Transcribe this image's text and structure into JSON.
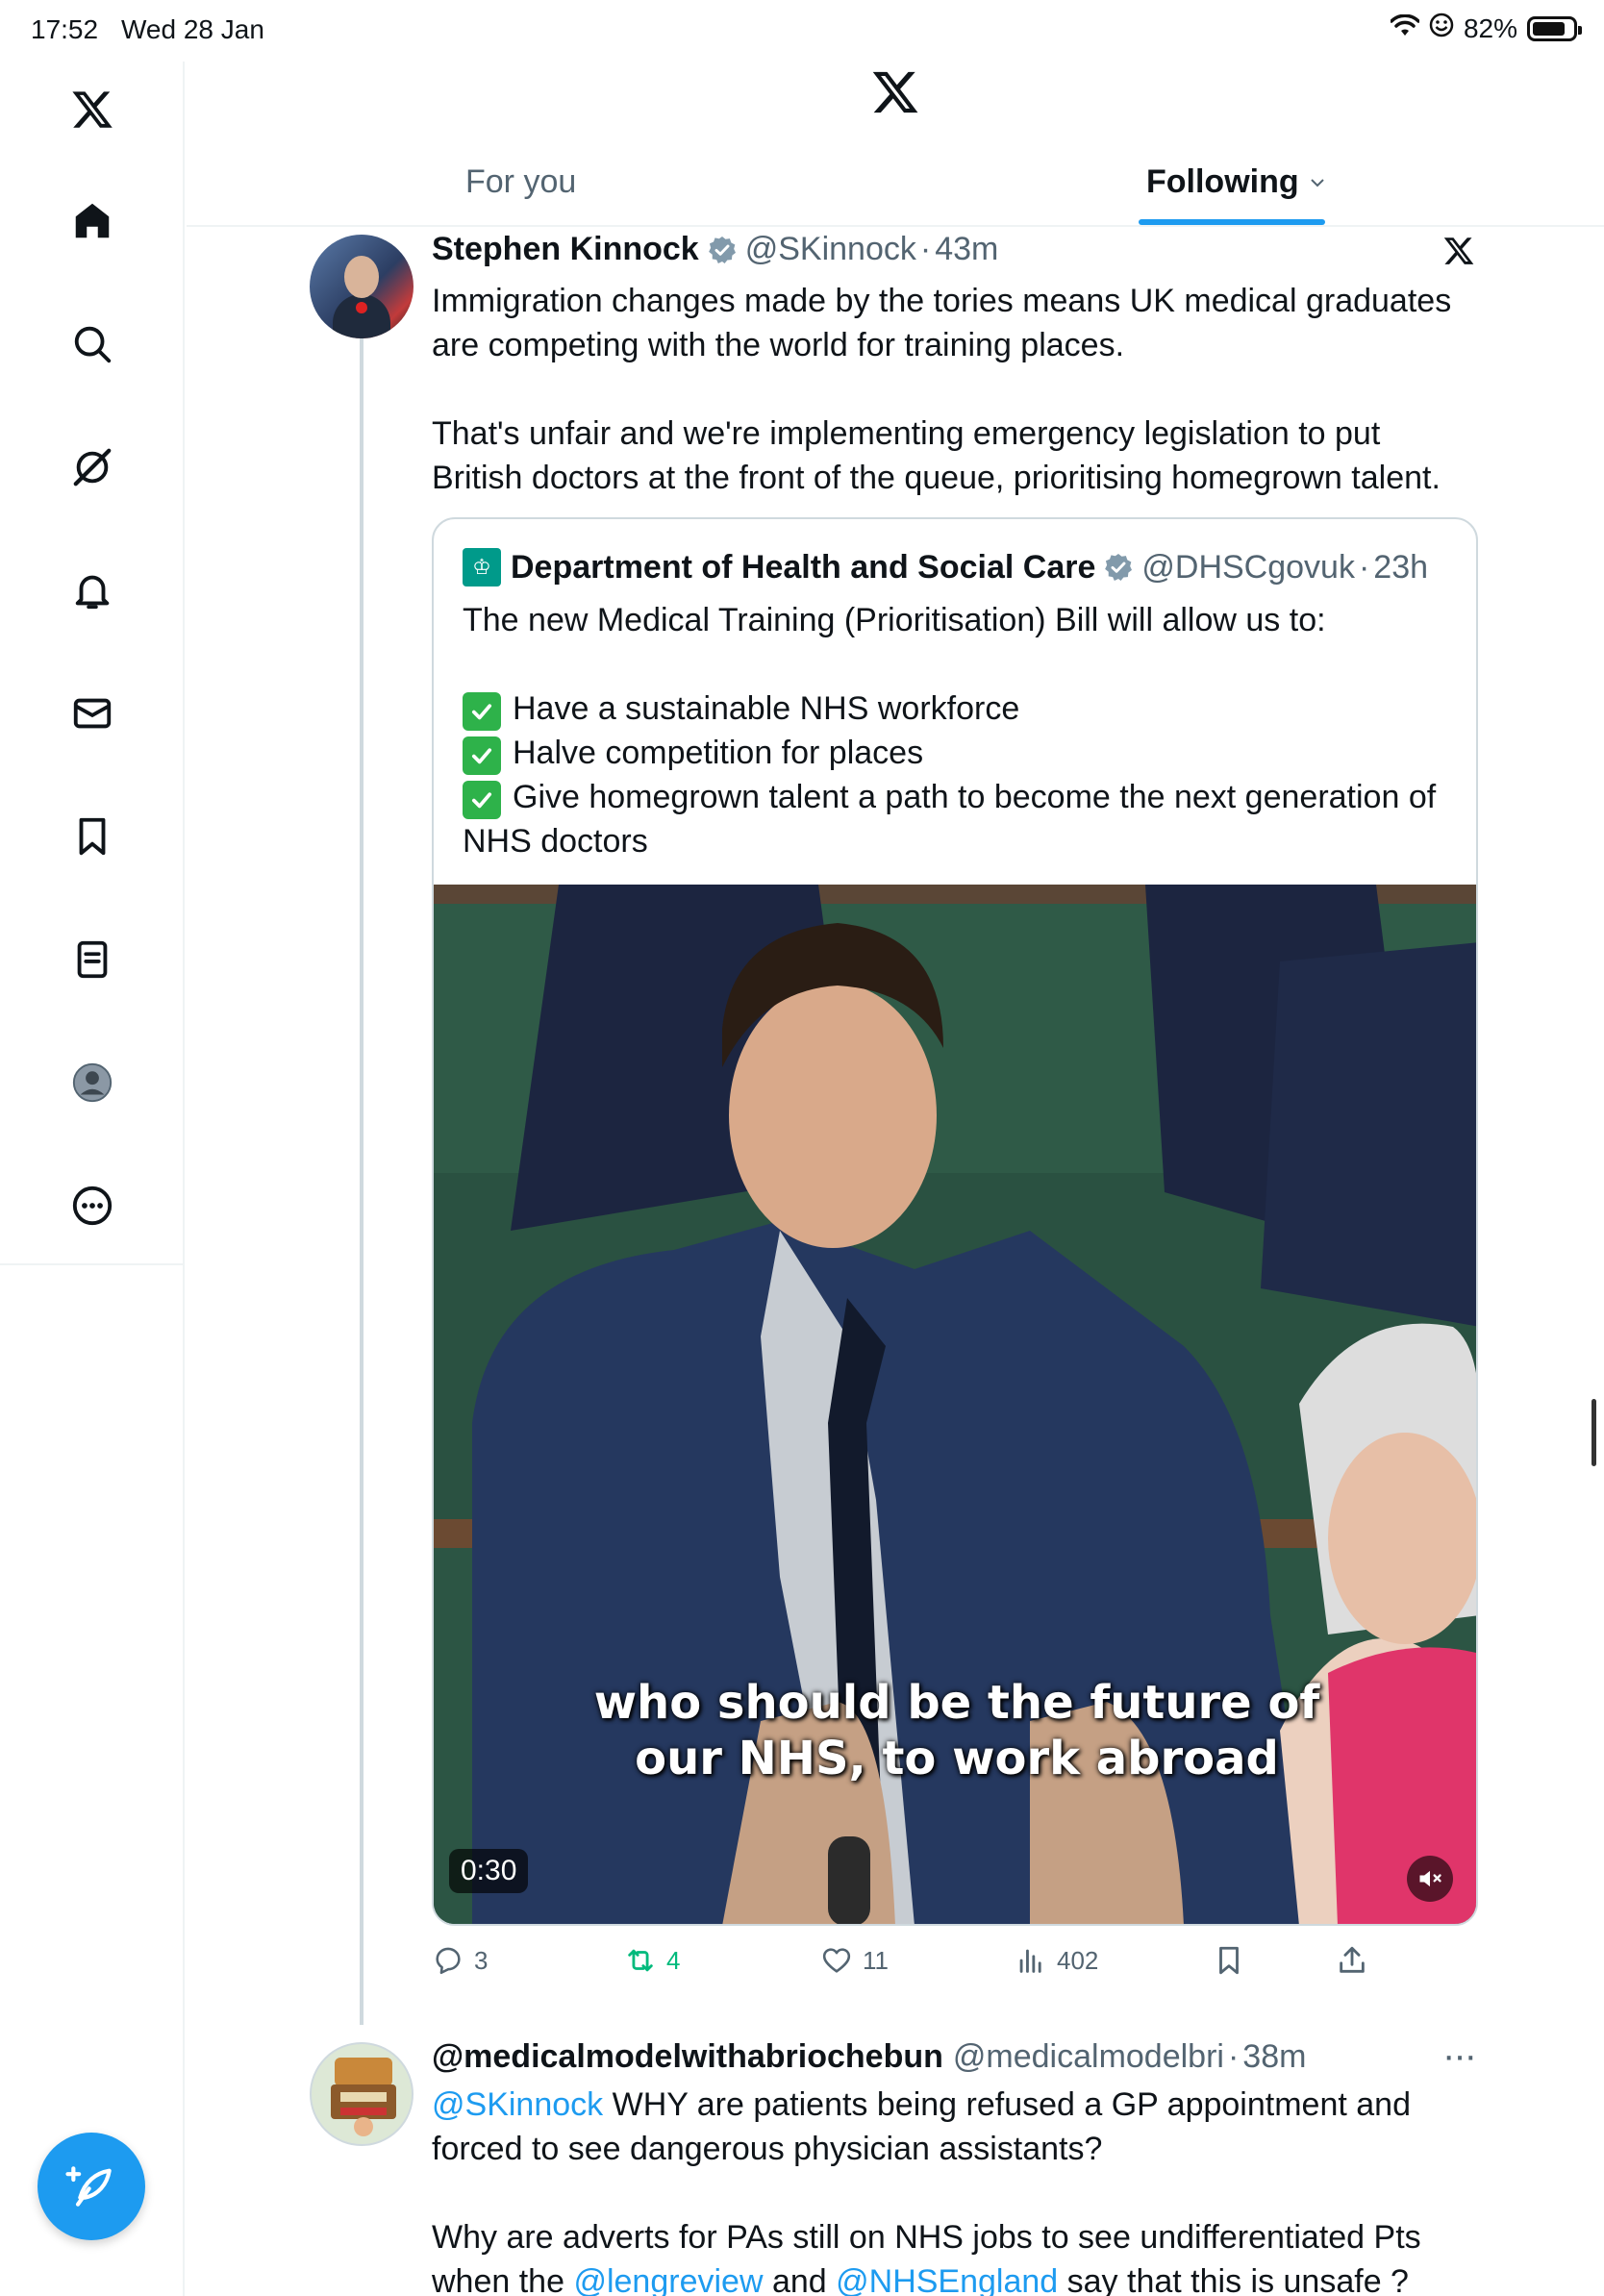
{
  "status_bar": {
    "time": "17:52",
    "date": "Wed 28 Jan",
    "battery_percent": "82%",
    "battery_level": 0.82
  },
  "header": {
    "tabs": [
      {
        "label": "For you",
        "selected": false
      },
      {
        "label": "Following",
        "selected": true
      }
    ]
  },
  "sidebar": {
    "items": [
      {
        "name": "home",
        "icon": "home-icon"
      },
      {
        "name": "explore",
        "icon": "search-icon"
      },
      {
        "name": "grok",
        "icon": "grok-icon"
      },
      {
        "name": "notifications",
        "icon": "bell-icon"
      },
      {
        "name": "messages",
        "icon": "envelope-icon"
      },
      {
        "name": "bookmarks",
        "icon": "bookmark-icon"
      },
      {
        "name": "lists",
        "icon": "list-icon"
      },
      {
        "name": "profile",
        "icon": "profile-avatar-icon"
      },
      {
        "name": "more",
        "icon": "more-circle-icon"
      }
    ]
  },
  "tweet": {
    "author_name": "Stephen Kinnock",
    "handle": "@SKinnock",
    "separator": "·",
    "time": "43m",
    "paragraphs": [
      "Immigration changes made by the tories means UK medical graduates are competing with the world for training places.",
      "That's unfair and we're implementing emergency legislation to put British doctors at the front of the queue, prioritising homegrown talent."
    ],
    "quote": {
      "author_name": "Department of Health and Social Care",
      "handle": "@DHSCgovuk",
      "separator": "·",
      "time": "23h",
      "intro": "The new Medical Training (Prioritisation) Bill will allow us to:",
      "bullets": [
        "Have a sustainable NHS workforce",
        "Halve competition for places",
        "Give homegrown talent a path to become the next generation of NHS doctors"
      ],
      "video": {
        "caption_line1": "who should be the future of",
        "caption_line2": "our NHS, to work abroad",
        "duration": "0:30"
      }
    },
    "stats": {
      "replies": "3",
      "reposts": "4",
      "likes": "11",
      "views": "402"
    }
  },
  "reply": {
    "author_name": "@medicalmodelwithabriochebun",
    "handle": "@medicalmodelbri",
    "separator": "·",
    "time": "38m",
    "mention1": "@SKinnock",
    "text1": " WHY are patients being refused a GP appointment and forced to see dangerous physician assistants?",
    "text2_a": "Why are adverts for PAs still on NHS jobs to see undifferentiated Pts when the ",
    "mention2": "@lengreview",
    "text2_b": " and ",
    "mention3": "@NHSEngland",
    "text2_c": " say that this is unsafe ?"
  },
  "colors": {
    "accent": "#1d9bf0",
    "repost": "#00ba7c",
    "secondary_text": "#536471",
    "border": "#eff3f4"
  }
}
